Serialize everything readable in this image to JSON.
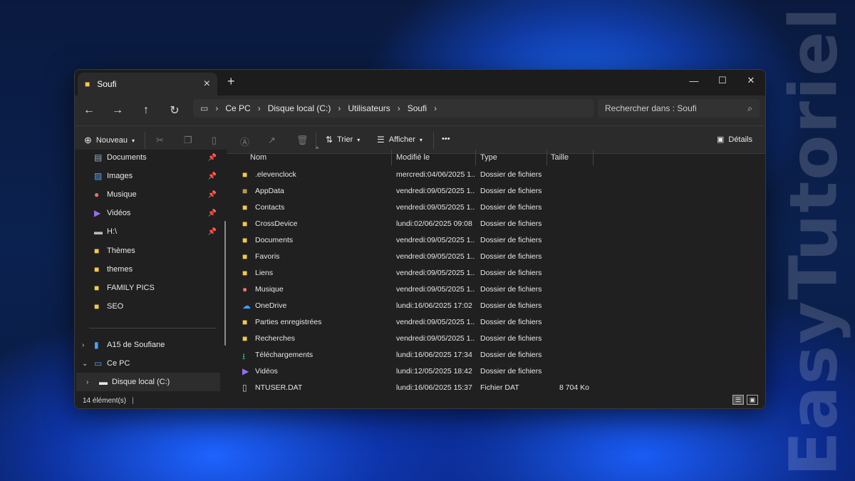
{
  "watermark": "EasyTutoriel",
  "window": {
    "tab_title": "Soufi",
    "new_tab": "+",
    "controls": {
      "minimize": "—",
      "maximize": "☐",
      "close": "✕"
    }
  },
  "nav": {
    "back": "←",
    "forward": "→",
    "up": "↑",
    "refresh": "↻",
    "breadcrumb": [
      "Ce PC",
      "Disque local (C:)",
      "Utilisateurs",
      "Soufi"
    ],
    "search_placeholder": "Rechercher dans : Soufi"
  },
  "toolbar": {
    "new_label": "Nouveau",
    "sort_label": "Trier",
    "view_label": "Afficher",
    "more_label": "•••",
    "details_label": "Détails"
  },
  "sidebar": {
    "quick": [
      {
        "label": "Documents",
        "icon": "document-icon",
        "pinned": true
      },
      {
        "label": "Images",
        "icon": "image-icon",
        "pinned": true
      },
      {
        "label": "Musique",
        "icon": "music-icon",
        "pinned": true
      },
      {
        "label": "Vidéos",
        "icon": "video-icon",
        "pinned": true
      },
      {
        "label": "H:\\",
        "icon": "drive-icon",
        "pinned": true
      },
      {
        "label": "Thèmes",
        "icon": "folder-icon",
        "pinned": false
      },
      {
        "label": "themes",
        "icon": "folder-icon",
        "pinned": false
      },
      {
        "label": "FAMILY PICS",
        "icon": "folder-icon",
        "pinned": false
      },
      {
        "label": "SEO",
        "icon": "folder-icon",
        "pinned": false
      }
    ],
    "tree": [
      {
        "label": "A15 de Soufiane",
        "icon": "phone-icon",
        "chevron": "›"
      },
      {
        "label": "Ce PC",
        "icon": "pc-icon",
        "chevron": "⌄"
      },
      {
        "label": "Disque local (C:)",
        "icon": "drive-icon",
        "chevron": "›"
      }
    ]
  },
  "columns": {
    "name": "Nom",
    "modified": "Modifié le",
    "type": "Type",
    "size": "Taille"
  },
  "files": [
    {
      "name": ".elevenclock",
      "modified": "mercredi:04/06/2025 1...",
      "type": "Dossier de fichiers",
      "size": "",
      "icon": "folder-icon"
    },
    {
      "name": "AppData",
      "modified": "vendredi:09/05/2025 1...",
      "type": "Dossier de fichiers",
      "size": "",
      "icon": "folder-hidden-icon"
    },
    {
      "name": "Contacts",
      "modified": "vendredi:09/05/2025 1...",
      "type": "Dossier de fichiers",
      "size": "",
      "icon": "folder-icon"
    },
    {
      "name": "CrossDevice",
      "modified": "lundi:02/06/2025 09:08",
      "type": "Dossier de fichiers",
      "size": "",
      "icon": "folder-icon"
    },
    {
      "name": "Documents",
      "modified": "vendredi:09/05/2025 1...",
      "type": "Dossier de fichiers",
      "size": "",
      "icon": "folder-icon"
    },
    {
      "name": "Favoris",
      "modified": "vendredi:09/05/2025 1...",
      "type": "Dossier de fichiers",
      "size": "",
      "icon": "folder-icon"
    },
    {
      "name": "Liens",
      "modified": "vendredi:09/05/2025 1...",
      "type": "Dossier de fichiers",
      "size": "",
      "icon": "folder-icon"
    },
    {
      "name": "Musique",
      "modified": "vendredi:09/05/2025 1...",
      "type": "Dossier de fichiers",
      "size": "",
      "icon": "music-icon"
    },
    {
      "name": "OneDrive",
      "modified": "lundi:16/06/2025 17:02",
      "type": "Dossier de fichiers",
      "size": "",
      "icon": "cloud-icon"
    },
    {
      "name": "Parties enregistrées",
      "modified": "vendredi:09/05/2025 1...",
      "type": "Dossier de fichiers",
      "size": "",
      "icon": "folder-icon"
    },
    {
      "name": "Recherches",
      "modified": "vendredi:09/05/2025 1...",
      "type": "Dossier de fichiers",
      "size": "",
      "icon": "folder-icon"
    },
    {
      "name": "Téléchargements",
      "modified": "lundi:16/06/2025 17:34",
      "type": "Dossier de fichiers",
      "size": "",
      "icon": "download-icon"
    },
    {
      "name": "Vidéos",
      "modified": "lundi:12/05/2025 18:42",
      "type": "Dossier de fichiers",
      "size": "",
      "icon": "video-icon"
    },
    {
      "name": "NTUSER.DAT",
      "modified": "lundi:16/06/2025 15:37",
      "type": "Fichier DAT",
      "size": "8 704 Ko",
      "icon": "file-icon"
    }
  ],
  "status": {
    "count": "14 élément(s)"
  },
  "colors": {
    "accent": "#0078d4",
    "folder": "#f5c84c",
    "bg": "#202020"
  }
}
